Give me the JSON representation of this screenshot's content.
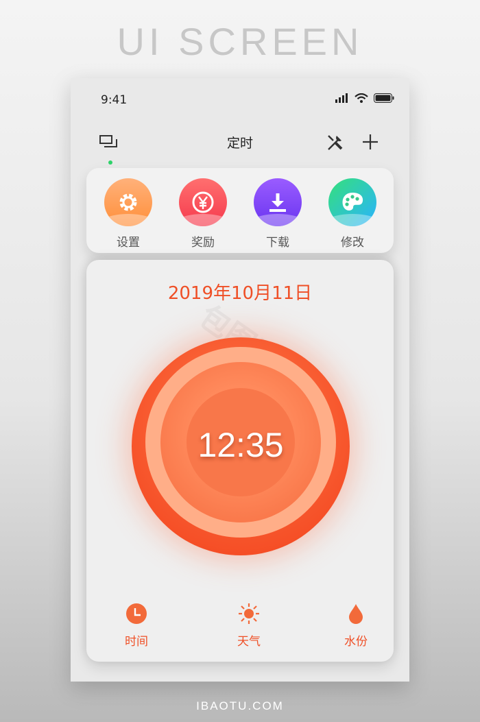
{
  "banner": {
    "title": "UI SCREEN",
    "footer": "IBAOTU.COM"
  },
  "status_bar": {
    "time": "9:41",
    "icons": [
      "signal-icon",
      "wifi-icon",
      "battery-icon"
    ]
  },
  "nav": {
    "title": "定时",
    "left_icon": "chat-icon",
    "right_icons": [
      "tools-icon",
      "plus-icon"
    ]
  },
  "quick_actions": [
    {
      "label": "设置",
      "icon": "gear-icon",
      "colors": [
        "#ffb17a",
        "#ff8f3a"
      ]
    },
    {
      "label": "奖励",
      "icon": "yen-icon",
      "colors": [
        "#ff6f6f",
        "#f53a4d"
      ]
    },
    {
      "label": "下载",
      "icon": "download-icon",
      "colors": [
        "#9a5cff",
        "#6a35f0"
      ]
    },
    {
      "label": "修改",
      "icon": "palette-icon",
      "colors": [
        "#35e07a",
        "#2ab3ff"
      ]
    }
  ],
  "main": {
    "date": "2019年10月11日",
    "time": "12:35",
    "watermark": "包图网"
  },
  "tabs": [
    {
      "label": "时间",
      "icon": "clock-icon"
    },
    {
      "label": "天气",
      "icon": "sun-icon"
    },
    {
      "label": "水份",
      "icon": "water-drop-icon"
    }
  ],
  "accent_color": "#ef4f26"
}
